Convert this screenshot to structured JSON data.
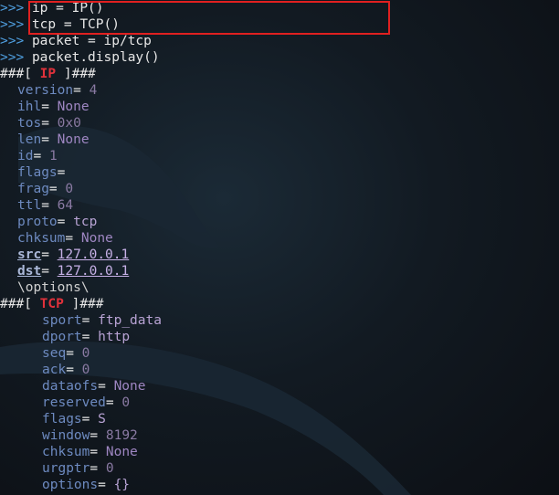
{
  "terminal": {
    "prompt": ">>>",
    "commands": [
      "ip = IP()",
      "tcp = TCP()",
      "packet = ip/tcp",
      "packet.display()"
    ],
    "header_prefix": "###[ ",
    "header_suffix": " ]###",
    "ip_layer": {
      "name": "IP",
      "fields": [
        {
          "name": "version",
          "value": "4"
        },
        {
          "name": "ihl",
          "value": "None"
        },
        {
          "name": "tos",
          "value": "0x0"
        },
        {
          "name": "len",
          "value": "None"
        },
        {
          "name": "id",
          "value": "1"
        },
        {
          "name": "flags",
          "value": ""
        },
        {
          "name": "frag",
          "value": "0"
        },
        {
          "name": "ttl",
          "value": "64"
        },
        {
          "name": "proto",
          "value": "tcp"
        },
        {
          "name": "chksum",
          "value": "None"
        },
        {
          "name": "src",
          "value": "127.0.0.1"
        },
        {
          "name": "dst",
          "value": "127.0.0.1"
        }
      ],
      "options_line": "\\options\\"
    },
    "tcp_layer": {
      "name": "TCP",
      "fields": [
        {
          "name": "sport",
          "value": "ftp_data"
        },
        {
          "name": "dport",
          "value": "http"
        },
        {
          "name": "seq",
          "value": "0"
        },
        {
          "name": "ack",
          "value": "0"
        },
        {
          "name": "dataofs",
          "value": "None"
        },
        {
          "name": "reserved",
          "value": "0"
        },
        {
          "name": "flags",
          "value": "S"
        },
        {
          "name": "window",
          "value": "8192"
        },
        {
          "name": "chksum",
          "value": "None"
        },
        {
          "name": "urgptr",
          "value": "0"
        },
        {
          "name": "options",
          "value": "{}"
        }
      ]
    }
  },
  "colors": {
    "prompt": "#4f9fe0",
    "layer_name": "#e0313b",
    "highlight_box": "#e02020",
    "background": "#0e1116"
  }
}
